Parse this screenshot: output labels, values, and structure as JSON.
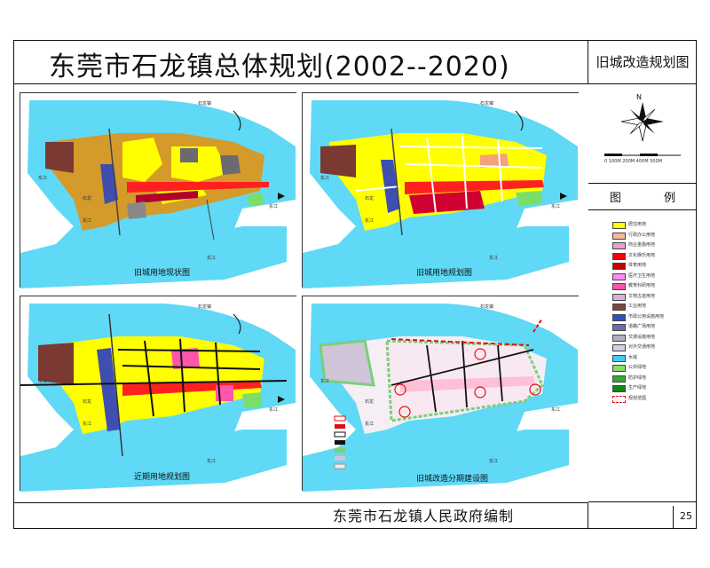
{
  "title": "东莞市石龙镇总体规划(2002--2020)",
  "side_header": "旧城改造规划图",
  "compass": {
    "north_label": "N",
    "scale_text": "0 100M 200M 400M 500M"
  },
  "legend": {
    "title": "图 例",
    "items": [
      {
        "label": "居住用地",
        "color": "#ffff00"
      },
      {
        "label": "行政办公用地",
        "color": "#f4b8a0"
      },
      {
        "label": "商业金融用地",
        "color": "#e8a0d0"
      },
      {
        "label": "文化娱乐用地",
        "color": "#ff0000"
      },
      {
        "label": "体育用地",
        "color": "#c00000"
      },
      {
        "label": "医疗卫生用地",
        "color": "#ff88ff"
      },
      {
        "label": "教育科研用地",
        "color": "#ff55aa"
      },
      {
        "label": "文物古迹用地",
        "color": "#d8b0e0"
      },
      {
        "label": "工业用地",
        "color": "#7a4a3a"
      },
      {
        "label": "市政公用设施用地",
        "color": "#3050c0"
      },
      {
        "label": "道路广场用地",
        "color": "#6b6bb0"
      },
      {
        "label": "交通设施用地",
        "color": "#b0b0c0"
      },
      {
        "label": "对外交通用地",
        "color": "#d0d0e8"
      },
      {
        "label": "水域",
        "color": "#44ccee"
      },
      {
        "label": "公共绿地",
        "color": "#88dd66"
      },
      {
        "label": "防护绿地",
        "color": "#33aa33"
      },
      {
        "label": "生产绿地",
        "color": "#118811"
      },
      {
        "label": "规划范围",
        "color": "#ffffff"
      }
    ]
  },
  "panels": [
    {
      "caption": "旧城用地现状图",
      "labels": [
        "石龙镇",
        "石龙",
        "东江",
        "东江",
        "东江",
        "东江"
      ]
    },
    {
      "caption": "旧城用地规划图",
      "labels": [
        "石龙镇",
        "石龙",
        "东江",
        "东江",
        "东江",
        "东江"
      ]
    },
    {
      "caption": "近期用地规划图",
      "labels": [
        "石龙镇",
        "石龙",
        "东江",
        "东江",
        "东江",
        "东江"
      ]
    },
    {
      "caption": "旧城改造分期建设图",
      "labels": [
        "石龙镇",
        "石龙",
        "东江",
        "东江",
        "东江",
        "东江"
      ]
    }
  ],
  "footer": "东莞市石龙镇人民政府编制",
  "page_number": "25"
}
